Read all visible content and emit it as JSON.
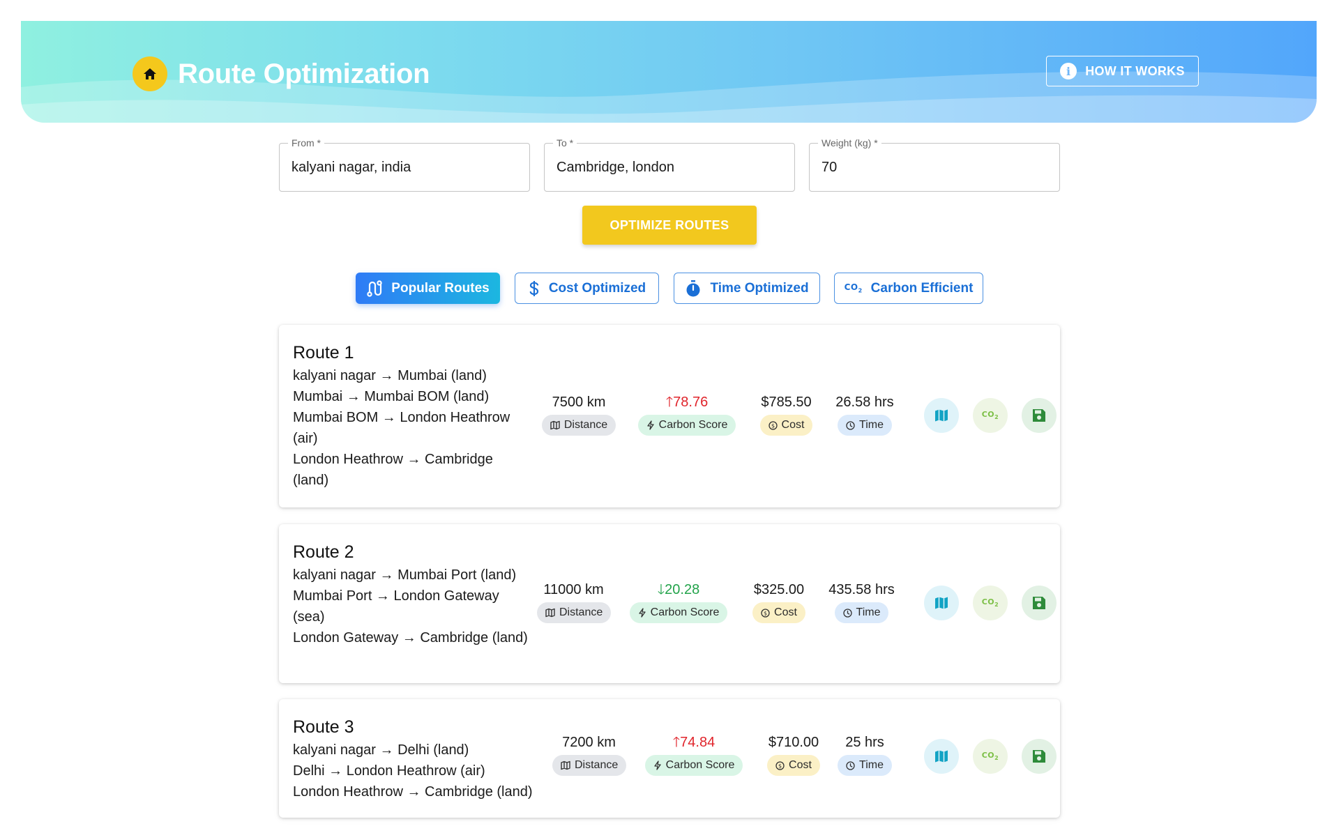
{
  "header": {
    "title": "Route Optimization",
    "home_icon": "home-icon",
    "how_it_works_label": "HOW IT WORKS",
    "info_glyph": "i"
  },
  "form": {
    "from": {
      "label": "From *",
      "value": "kalyani nagar, india"
    },
    "to": {
      "label": "To *",
      "value": "Cambridge, london"
    },
    "weight": {
      "label": "Weight (kg) *",
      "value": "70"
    },
    "optimize_label": "OPTIMIZE ROUTES"
  },
  "tabs": [
    {
      "label": "Popular Routes",
      "icon": "route-icon",
      "active": true
    },
    {
      "label": "Cost Optimized",
      "icon": "dollar-icon",
      "active": false
    },
    {
      "label": "Time Optimized",
      "icon": "timer-icon",
      "active": false
    },
    {
      "label": "Carbon Efficient",
      "icon": "co2-icon",
      "active": false
    }
  ],
  "chip_labels": {
    "distance": "Distance",
    "carbon": "Carbon Score",
    "cost": "Cost",
    "time": "Time"
  },
  "routes": [
    {
      "title": "Route 1",
      "legs": [
        "kalyani nagar → Mumbai (land)",
        "Mumbai → Mumbai BOM (land)",
        "Mumbai BOM → London Heathrow (air)",
        "London Heathrow → Cambridge (land)"
      ],
      "distance": "7500 km",
      "carbon_score": "78.76",
      "carbon_trend": "up",
      "cost": "$785.50",
      "time": "26.58 hrs"
    },
    {
      "title": "Route 2",
      "legs": [
        "kalyani nagar → Mumbai Port (land)",
        "Mumbai Port → London Gateway (sea)",
        "London Gateway → Cambridge (land)"
      ],
      "distance": "11000 km",
      "carbon_score": "20.28",
      "carbon_trend": "down",
      "cost": "$325.00",
      "time": "435.58 hrs"
    },
    {
      "title": "Route 3",
      "legs": [
        "kalyani nagar → Delhi (land)",
        "Delhi → London Heathrow (air)",
        "London Heathrow → Cambridge (land)"
      ],
      "distance": "7200 km",
      "carbon_score": "74.84",
      "carbon_trend": "up",
      "cost": "$710.00",
      "time": "25 hrs"
    }
  ],
  "colors": {
    "accent_yellow": "#f2c81e",
    "tab_blue": "#1a6fd6",
    "carbon_up": "#e0242b",
    "carbon_down": "#22a34a"
  }
}
